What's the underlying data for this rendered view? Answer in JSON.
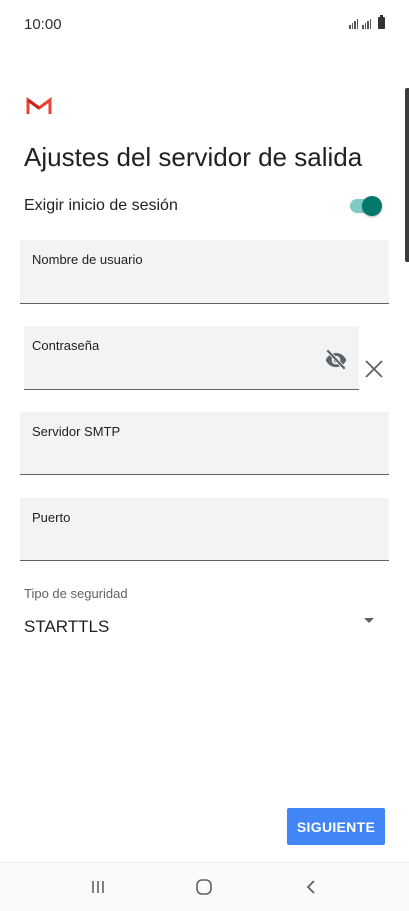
{
  "status_bar": {
    "time": "10:00"
  },
  "app": {
    "logo_icon": "gmail-m-icon",
    "logo_colors": [
      "#ea4335",
      "#c5221f"
    ]
  },
  "page": {
    "title": "Ajustes del servidor de salida"
  },
  "require_signin": {
    "label": "Exigir inicio de sesión",
    "enabled": true,
    "accent_color": "#00796b"
  },
  "fields": {
    "username": {
      "label": "Nombre de usuario",
      "value": ""
    },
    "password": {
      "label": "Contraseña",
      "value": "",
      "visibility_icon": "eye-off-icon",
      "clear_icon": "close-icon"
    },
    "smtp_server": {
      "label": "Servidor SMTP",
      "value": ""
    },
    "port": {
      "label": "Puerto",
      "value": ""
    }
  },
  "security": {
    "label": "Tipo de seguridad",
    "value": "STARTTLS",
    "dropdown_icon": "dropdown-arrow-icon"
  },
  "actions": {
    "next_label": "SIGUIENTE",
    "next_color": "#4285f4"
  },
  "nav": {
    "icons": [
      "recent-apps-icon",
      "home-icon",
      "back-icon"
    ]
  }
}
